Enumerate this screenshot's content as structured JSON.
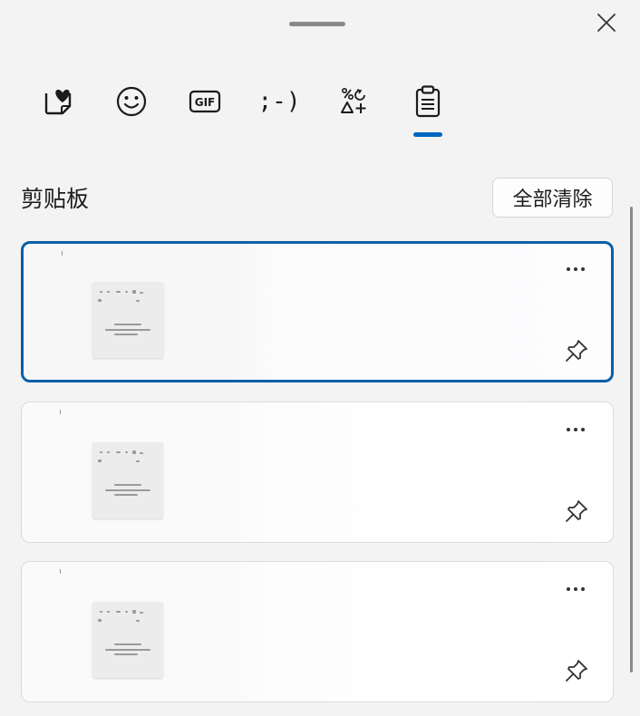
{
  "header": {
    "close_icon": "close-icon"
  },
  "tabs": [
    {
      "name": "favorites",
      "icon": "heart-sticker-icon"
    },
    {
      "name": "emoji",
      "icon": "smiley-icon"
    },
    {
      "name": "gif",
      "icon": "gif-icon",
      "label": "GIF"
    },
    {
      "name": "kaomoji",
      "icon": "kaomoji-icon",
      "label": ";-)"
    },
    {
      "name": "symbols",
      "icon": "symbols-icon"
    },
    {
      "name": "clipboard",
      "icon": "clipboard-icon",
      "selected": true
    }
  ],
  "clipboard": {
    "title": "剪贴板",
    "clear_all_label": "全部清除",
    "items": [
      {
        "type": "image",
        "selected": true
      },
      {
        "type": "image",
        "selected": false
      },
      {
        "type": "image",
        "selected": false
      }
    ]
  },
  "colors": {
    "accent": "#0067c0",
    "selected_border": "#0a5ea8",
    "background": "#f3f3f3"
  }
}
